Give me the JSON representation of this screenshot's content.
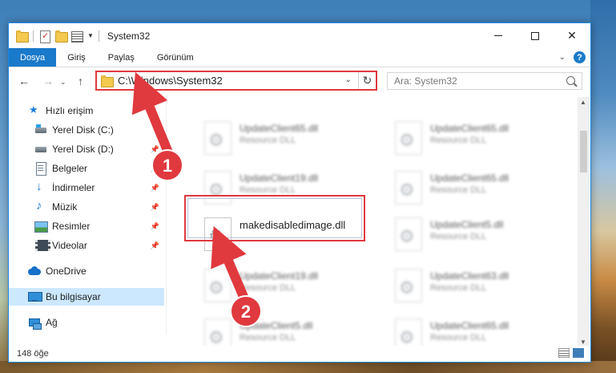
{
  "window": {
    "title": "System32"
  },
  "ribbon": {
    "tabs": [
      "Dosya",
      "Giriş",
      "Paylaş",
      "Görünüm"
    ],
    "help": "?"
  },
  "address_bar": {
    "path": "C:\\Windows\\System32",
    "search_placeholder": "Ara: System32"
  },
  "sidebar": {
    "items": [
      {
        "label": "Hızlı erişim",
        "icon": "star-icon"
      },
      {
        "label": "Yerel Disk (C:)",
        "icon": "disk-c-icon"
      },
      {
        "label": "Yerel Disk (D:)",
        "icon": "disk-d-icon"
      },
      {
        "label": "Belgeler",
        "icon": "documents-icon"
      },
      {
        "label": "İndirmeler",
        "icon": "downloads-icon"
      },
      {
        "label": "Müzik",
        "icon": "music-icon"
      },
      {
        "label": "Resimler",
        "icon": "pictures-icon"
      },
      {
        "label": "Videolar",
        "icon": "videos-icon"
      },
      {
        "label": "OneDrive",
        "icon": "onedrive-icon"
      },
      {
        "label": "Bu bilgisayar",
        "icon": "this-pc-icon"
      },
      {
        "label": "Ağ",
        "icon": "network-icon"
      }
    ]
  },
  "files": [
    {
      "name": "UpdateClient65.dll",
      "type": "Resource DLL"
    },
    {
      "name": "UpdateClient65.dll",
      "type": "Resource DLL"
    },
    {
      "name": "UpdateClient65.dll",
      "type": "Resource DLL"
    },
    {
      "name": "UpdateClient65.dll",
      "type": "Resource DLL"
    },
    {
      "name": "UpdateClient19.dll",
      "type": "Resource DLL"
    },
    {
      "name": "UpdateClient65.dll",
      "type": "Resource DLL"
    },
    {
      "name": "makedisabledimage.dll",
      "type": ""
    },
    {
      "name": "UpdateClient5.dll",
      "type": "Resource DLL"
    },
    {
      "name": "UpdateClient19.dll",
      "type": "Resource DLL"
    },
    {
      "name": "UpdateClient63.dll",
      "type": "Resource DLL"
    },
    {
      "name": "UpdateClient5.dll",
      "type": "Resource DLL"
    },
    {
      "name": "UpdateClient65.dll",
      "type": "Resource DLL"
    }
  ],
  "status": {
    "item_count": "148 öğe"
  },
  "annotations": {
    "step1": "1",
    "step2": "2",
    "color": "#e0393e"
  }
}
